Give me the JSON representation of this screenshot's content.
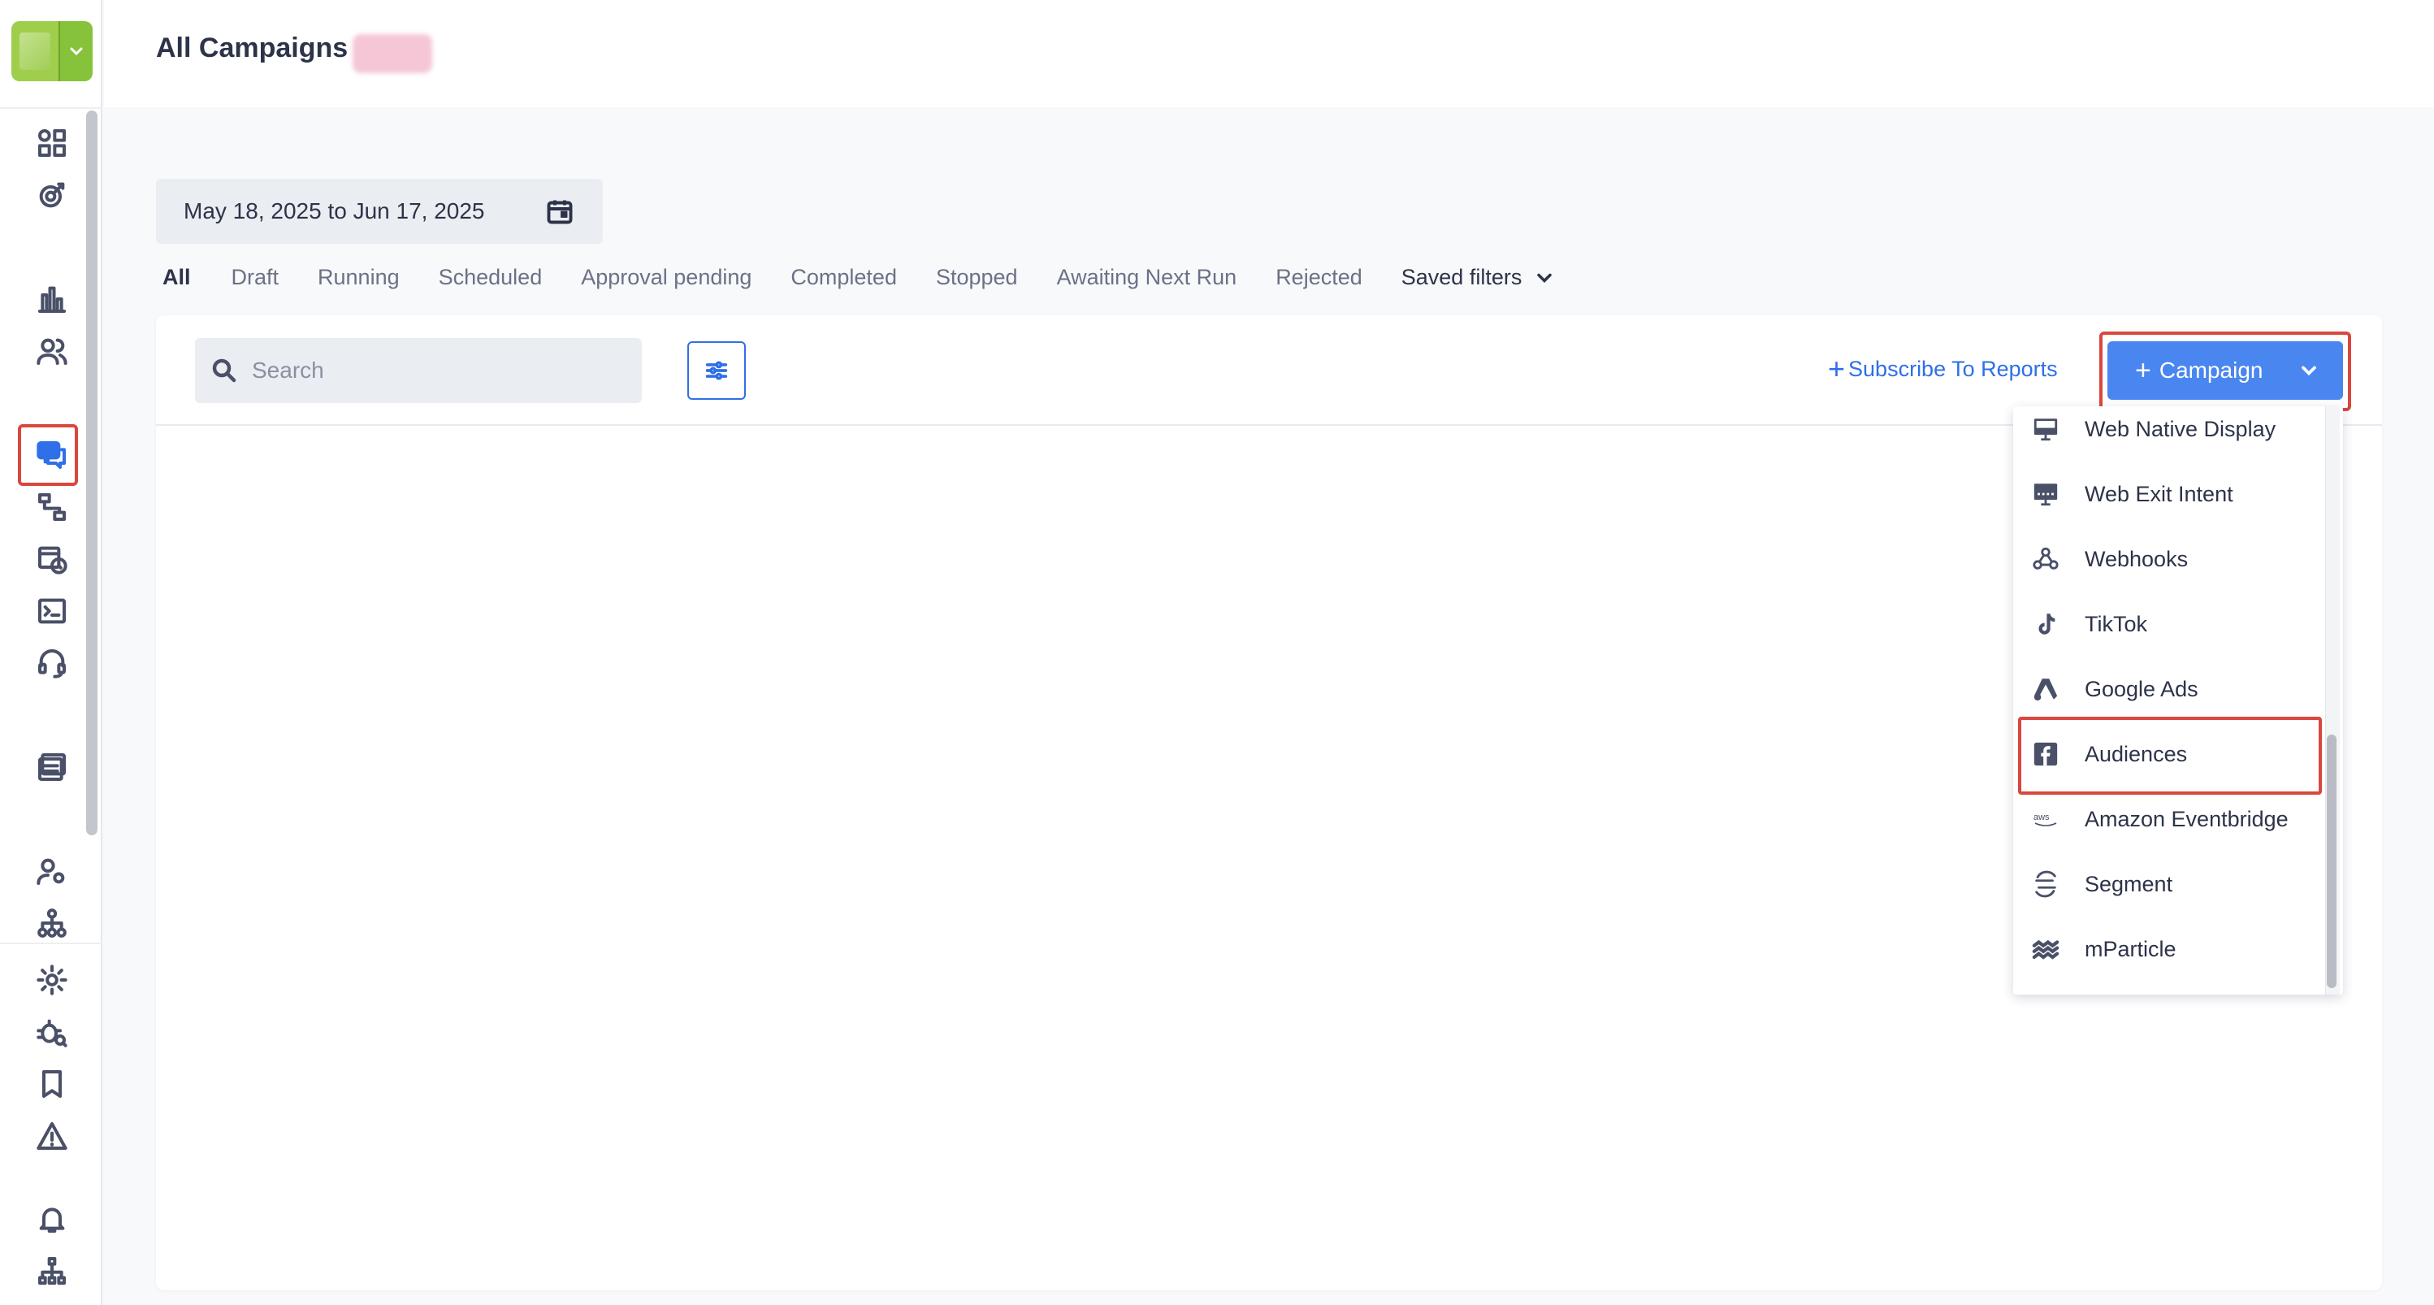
{
  "header": {
    "title": "All Campaigns"
  },
  "date_range": {
    "value": "May 18, 2025 to Jun 17, 2025"
  },
  "tabs": [
    {
      "label": "All"
    },
    {
      "label": "Draft"
    },
    {
      "label": "Running"
    },
    {
      "label": "Scheduled"
    },
    {
      "label": "Approval pending"
    },
    {
      "label": "Completed"
    },
    {
      "label": "Stopped"
    },
    {
      "label": "Awaiting Next Run"
    },
    {
      "label": "Rejected"
    }
  ],
  "saved_filters": {
    "label": "Saved filters"
  },
  "search": {
    "placeholder": "Search"
  },
  "toolbar": {
    "subscribe_plus": "+",
    "subscribe_label": "Subscribe To Reports",
    "campaign_plus": "+",
    "campaign_label": "Campaign"
  },
  "dropdown": {
    "items": [
      {
        "label": "Web Native Display",
        "icon": "monitor-icon"
      },
      {
        "label": "Web Exit Intent",
        "icon": "exit-intent-icon"
      },
      {
        "label": "Webhooks",
        "icon": "webhooks-icon"
      },
      {
        "label": "TikTok",
        "icon": "tiktok-icon"
      },
      {
        "label": "Google Ads",
        "icon": "google-ads-icon"
      },
      {
        "label": "Audiences",
        "icon": "facebook-icon"
      },
      {
        "label": "Amazon Eventbridge",
        "icon": "aws-icon"
      },
      {
        "label": "Segment",
        "icon": "segment-icon"
      },
      {
        "label": "mParticle",
        "icon": "mparticle-icon"
      }
    ],
    "aws_text": "aws"
  },
  "colors": {
    "accent": "#2f6fe8",
    "primary_button": "#4a86f0",
    "highlight": "#d9473d",
    "brand_green": "#87c23b"
  }
}
